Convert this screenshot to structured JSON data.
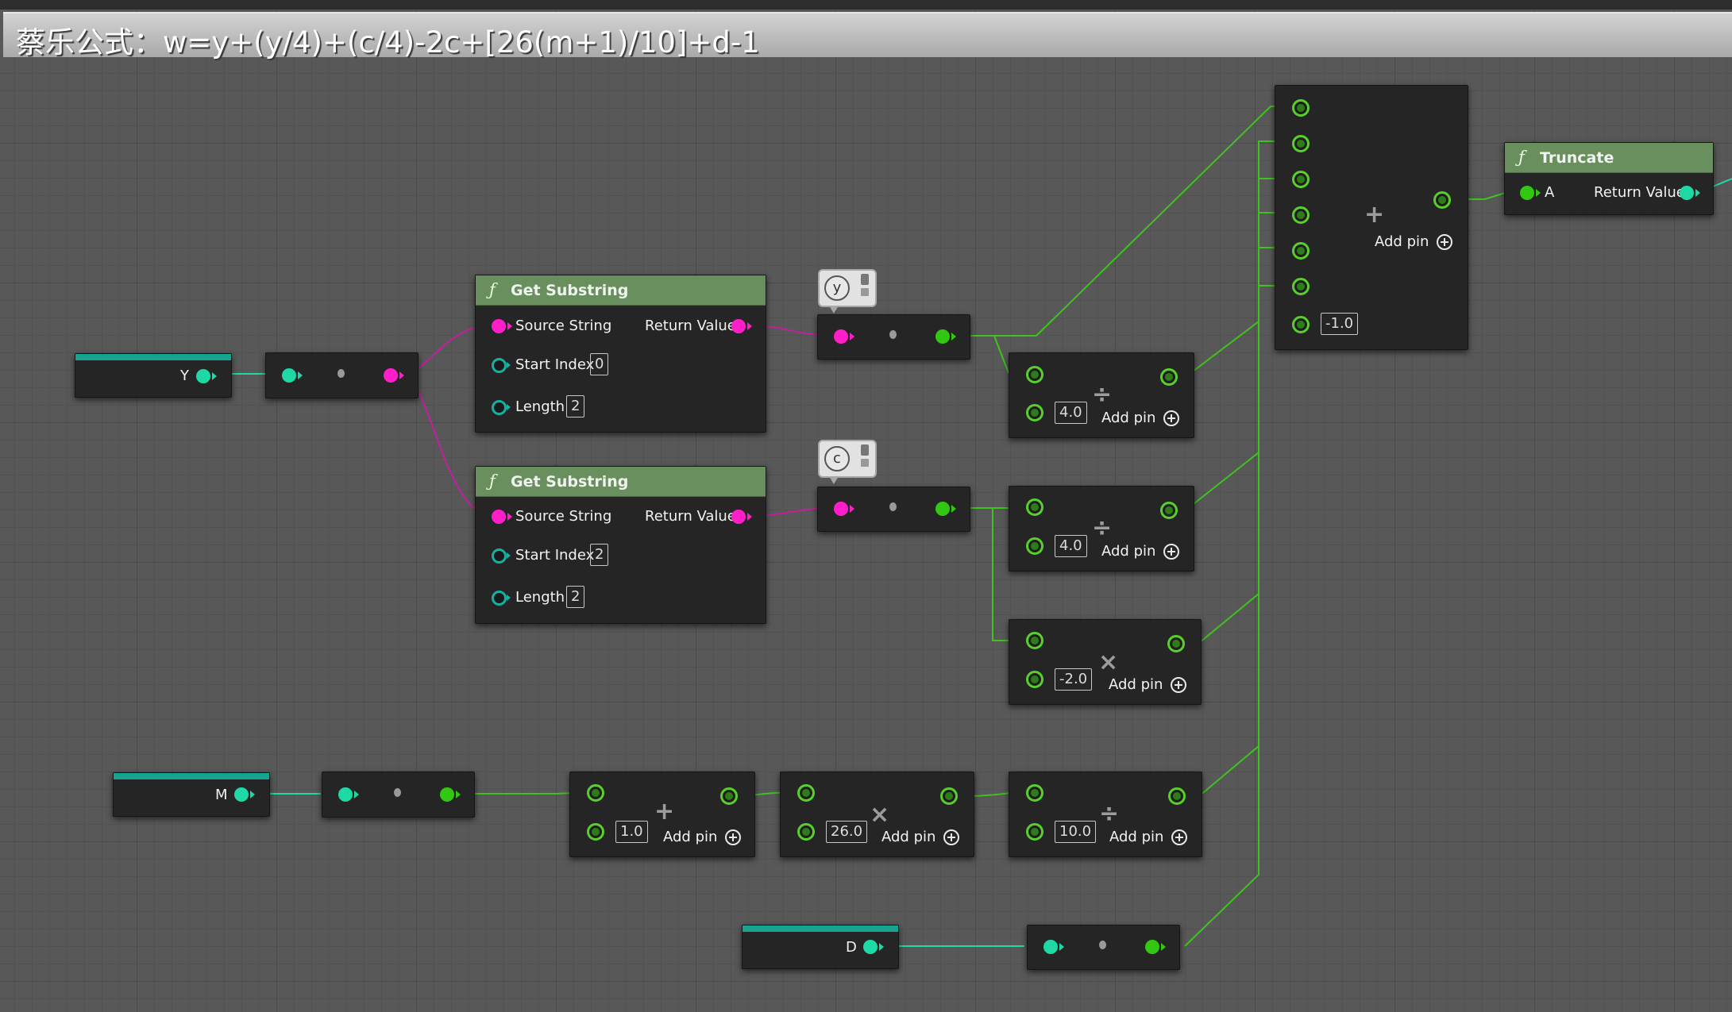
{
  "comment": {
    "title": "蔡乐公式：w=y+(y/4)+(c/4)-2c+[26(m+1)/10]+d-1"
  },
  "variables": {
    "y_label": "Y",
    "m_label": "M",
    "d_label": "D"
  },
  "substring1": {
    "title": "Get Substring",
    "source_label": "Source String",
    "return_label": "Return Value",
    "start_label": "Start Index",
    "start_value": "0",
    "length_label": "Length",
    "length_value": "2"
  },
  "substring2": {
    "title": "Get Substring",
    "source_label": "Source String",
    "return_label": "Return Value",
    "start_label": "Start Index",
    "start_value": "2",
    "length_label": "Length",
    "length_value": "2"
  },
  "comments": {
    "y_comment": "y",
    "c_comment": "c"
  },
  "add_pin_label": "Add pin",
  "ops": {
    "plus": "+",
    "divide": "÷",
    "multiply": "×"
  },
  "div_y": {
    "value": "4.0"
  },
  "div_c": {
    "value": "4.0"
  },
  "mul_c": {
    "value": "-2.0"
  },
  "add_m": {
    "value": "1.0"
  },
  "mul_m": {
    "value": "26.0"
  },
  "div_m": {
    "value": "10.0"
  },
  "big_add": {
    "value": "-1.0"
  },
  "truncate": {
    "title": "Truncate",
    "a_label": "A",
    "return_label": "Return Value"
  },
  "colors": {
    "exec_green": "#4ed22a",
    "string_magenta": "#ff1ec8",
    "int_cyan": "#1ed9a6",
    "func_header": "#6a8f5f"
  }
}
